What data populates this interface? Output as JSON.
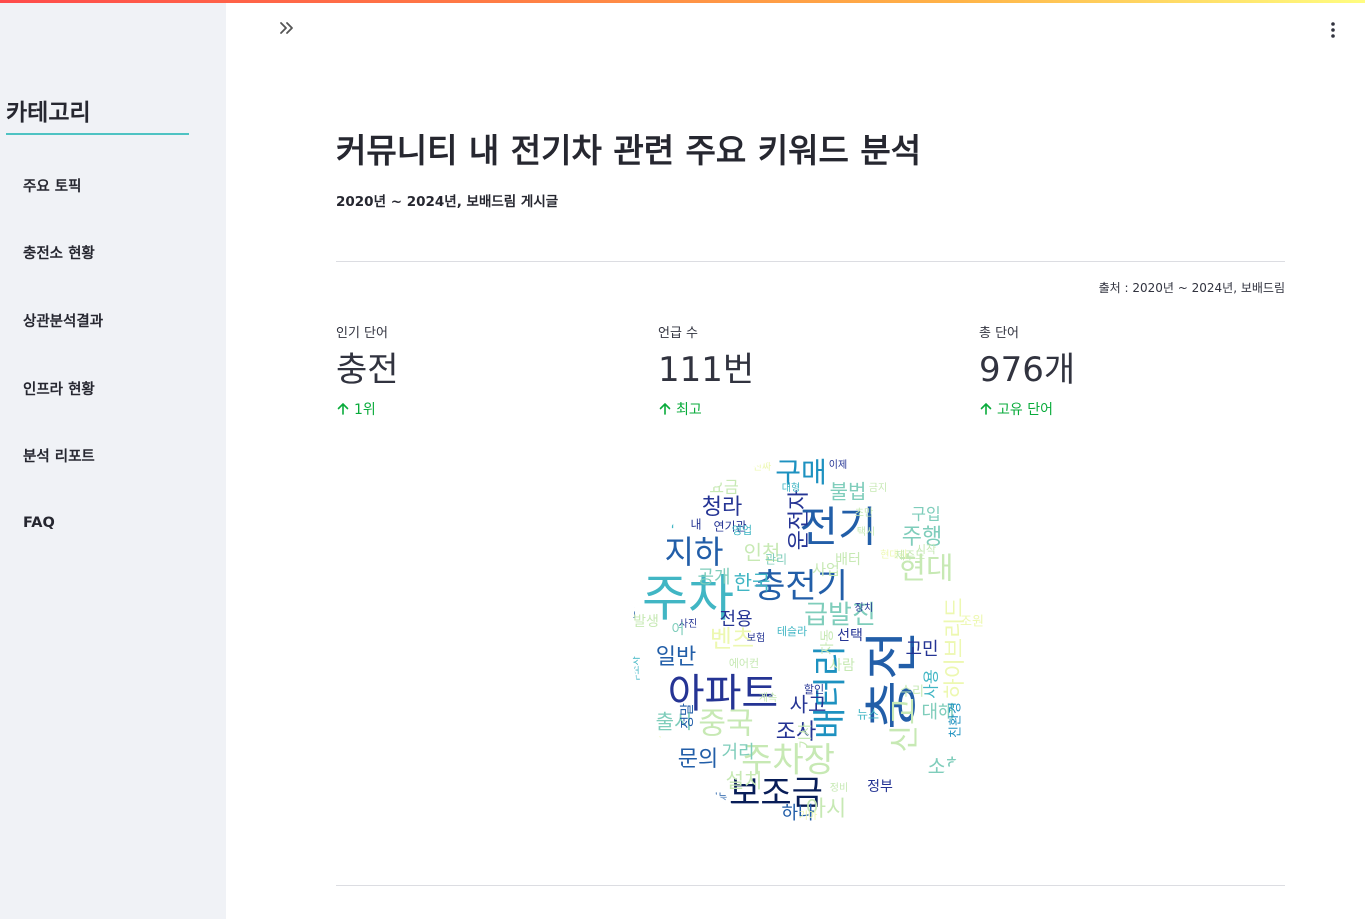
{
  "sidebar": {
    "title": "카테고리",
    "items": [
      {
        "label": "주요 토픽"
      },
      {
        "label": "충전소 현황"
      },
      {
        "label": "상관분석결과"
      },
      {
        "label": "인프라 현황"
      },
      {
        "label": "분석 리포트"
      },
      {
        "label": "FAQ"
      }
    ]
  },
  "header": {
    "expand_icon": "double-chevron-right-icon",
    "menu_icon": "vertical-ellipsis-icon"
  },
  "main": {
    "title": "커뮤니티 내 전기차 관련 주요 키워드 분석",
    "subtitle": "2020년 ~ 2024년, 보배드림 게시글",
    "source": "출처 : 2020년 ~ 2024년, 보배드림",
    "metrics": [
      {
        "label": "인기 단어",
        "value": "충전",
        "delta": "1위"
      },
      {
        "label": "언급 수",
        "value": "111번",
        "delta": "최고"
      },
      {
        "label": "총 단어",
        "value": "976개",
        "delta": "고유 단어"
      }
    ]
  },
  "colors": {
    "accent_underline": "#4ec3c3",
    "delta_green": "#09ab3b",
    "sidebar_bg": "#f0f2f6"
  },
  "wordcloud": {
    "words": [
      {
        "t": "충전",
        "c": "#225ea8"
      },
      {
        "t": "주차",
        "c": "#41b6c4"
      },
      {
        "t": "아파트",
        "c": "#253494"
      },
      {
        "t": "전기",
        "c": "#225ea8"
      },
      {
        "t": "배터리",
        "c": "#1d91c0"
      },
      {
        "t": "충전기",
        "c": "#225ea8"
      },
      {
        "t": "주차장",
        "c": "#c7e9b4"
      },
      {
        "t": "보조금",
        "c": "#081d58"
      },
      {
        "t": "지하",
        "c": "#225ea8"
      },
      {
        "t": "구매",
        "c": "#1d91c0"
      },
      {
        "t": "신고",
        "c": "#c7e9b4"
      },
      {
        "t": "중국",
        "c": "#c7e9b4"
      },
      {
        "t": "급발진",
        "c": "#7fcdbb"
      },
      {
        "t": "현대",
        "c": "#c7e9b4"
      },
      {
        "t": "운전자",
        "c": "#253494"
      },
      {
        "t": "하이브리드",
        "c": "#edf8b1"
      },
      {
        "t": "벤츠",
        "c": "#edf8b1"
      },
      {
        "t": "일반",
        "c": "#225ea8"
      },
      {
        "t": "한국",
        "c": "#41b6c4"
      },
      {
        "t": "문의",
        "c": "#225ea8"
      },
      {
        "t": "조사",
        "c": "#253494"
      },
      {
        "t": "사고",
        "c": "#253494"
      },
      {
        "t": "청라",
        "c": "#253494"
      },
      {
        "t": "주행",
        "c": "#7fcdbb"
      },
      {
        "t": "출시",
        "c": "#7fcdbb"
      },
      {
        "t": "소형",
        "c": "#7fcdbb"
      },
      {
        "t": "인천",
        "c": "#c7e9b4"
      },
      {
        "t": "불법",
        "c": "#7fcdbb"
      },
      {
        "t": "설치",
        "c": "#c7e9b4"
      },
      {
        "t": "대해",
        "c": "#7fcdbb"
      },
      {
        "t": "아시",
        "c": "#c7e9b4"
      },
      {
        "t": "전용",
        "c": "#253494"
      },
      {
        "t": "고민",
        "c": "#253494"
      },
      {
        "t": "공개",
        "c": "#7fcdbb"
      },
      {
        "t": "거리",
        "c": "#7fcdbb"
      },
      {
        "t": "사용",
        "c": "#41b6c4"
      },
      {
        "t": "하나",
        "c": "#225ea8"
      },
      {
        "t": "요금",
        "c": "#c7e9b4"
      },
      {
        "t": "구입",
        "c": "#7fcdbb"
      },
      {
        "t": "회사",
        "c": "#41b6c4"
      },
      {
        "t": "선택",
        "c": "#253494"
      },
      {
        "t": "정부",
        "c": "#253494"
      },
      {
        "t": "정말",
        "c": "#225ea8"
      },
      {
        "t": "친환경",
        "c": "#1d91c0"
      },
      {
        "t": "뉴스",
        "c": "#41b6c4"
      },
      {
        "t": "연기관",
        "c": "#253494"
      },
      {
        "t": "내",
        "c": "#253494"
      },
      {
        "t": "영업",
        "c": "#41b6c4"
      },
      {
        "t": "사진",
        "c": "#253494"
      },
      {
        "t": "보험",
        "c": "#253494"
      },
      {
        "t": "테슬라",
        "c": "#41b6c4"
      },
      {
        "t": "에어컨",
        "c": "#c7e9b4"
      },
      {
        "t": "할인",
        "c": "#253494"
      },
      {
        "t": "계속",
        "c": "#c7e9b4"
      },
      {
        "t": "기능",
        "c": "#225ea8"
      },
      {
        "t": "정비",
        "c": "#c7e9b4"
      },
      {
        "t": "기아",
        "c": "#edf8b1"
      },
      {
        "t": "이제",
        "c": "#253494"
      },
      {
        "t": "대형",
        "c": "#41b6c4"
      },
      {
        "t": "금지",
        "c": "#c7e9b4"
      },
      {
        "t": "초만",
        "c": "#c7e9b4"
      },
      {
        "t": "장치",
        "c": "#253494"
      },
      {
        "t": "한번",
        "c": "#225ea8"
      },
      {
        "t": "수소차",
        "c": "#41b6c4"
      },
      {
        "t": "현대차",
        "c": "#edf8b1"
      },
      {
        "t": "택시",
        "c": "#c7e9b4"
      },
      {
        "t": "관리",
        "c": "#7fcdbb"
      },
      {
        "t": "코나",
        "c": "#edf8b1"
      },
      {
        "t": "발생",
        "c": "#c7e9b4"
      },
      {
        "t": "질문",
        "c": "#edf8b1"
      },
      {
        "t": "진짜",
        "c": "#edf8b1"
      },
      {
        "t": "어",
        "c": "#7fcdbb"
      },
      {
        "t": "사업",
        "c": "#c7e9b4"
      },
      {
        "t": "자동",
        "c": "#c7e9b4"
      },
      {
        "t": "기사",
        "c": "#c7e9b4"
      },
      {
        "t": "시작",
        "c": "#c7e9b4"
      },
      {
        "t": "제주도",
        "c": "#c7e9b4"
      },
      {
        "t": "배터",
        "c": "#c7e9b4"
      },
      {
        "t": "수리",
        "c": "#c7e9b4"
      },
      {
        "t": "조원",
        "c": "#edf8b1"
      },
      {
        "t": "사람",
        "c": "#c7e9b4"
      }
    ]
  }
}
